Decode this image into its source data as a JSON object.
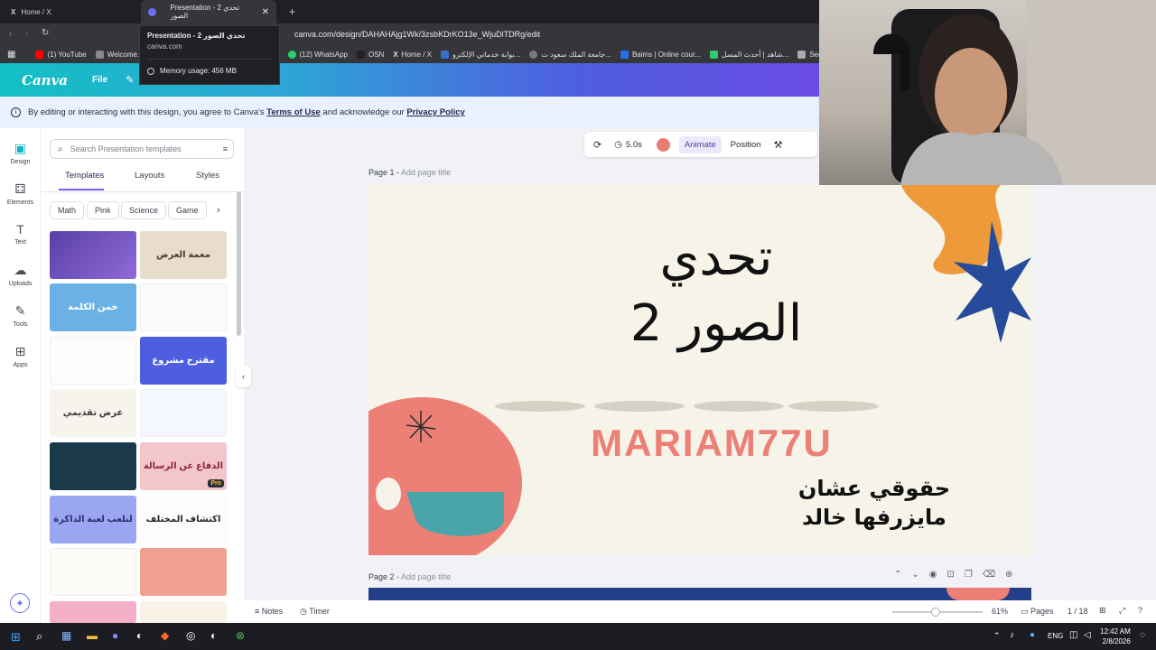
{
  "browser": {
    "tabs": [
      {
        "label": "Home / X",
        "active": false
      },
      {
        "label": "Presentation - 2 تحدي الصور",
        "active": true
      }
    ],
    "url": "canva.com/design/DAHAHAjg1Wk/3zsbKDrKO13e_WjuDlTDRg/edit",
    "tooltip": {
      "title": "Presentation - 2 تحدي الصور",
      "domain": "canva.com",
      "memory": "Memory usage: 456 MB"
    },
    "bookmarks": [
      {
        "label": "(1) YouTube",
        "color": "#ff0000"
      },
      {
        "label": "Welcome...",
        "color": "#888888"
      },
      {
        "label": "(12) WhatsApp",
        "color": "#25d366"
      },
      {
        "label": "OSN",
        "color": "#222222"
      },
      {
        "label": "Home / X",
        "color": "#000000"
      },
      {
        "label": "بوابة خدماتي الإلكترو...",
        "color": "#3b6ccb"
      },
      {
        "label": "جامعة الملك سعود ت...",
        "color": "#7a7a7a"
      },
      {
        "label": "Baims | Online cour...",
        "color": "#2a6ef0"
      },
      {
        "label": "شاهد | أحدث المسل...",
        "color": "#2ecc71"
      },
      {
        "label": "See",
        "color": "#aaaaaa"
      }
    ]
  },
  "canva": {
    "logo": "Canva",
    "menu_file": "File",
    "notice": {
      "prefix": "By editing or interacting with this design, you agree to Canva's",
      "terms": "Terms of Use",
      "middle": "and acknowledge our",
      "privacy": "Privacy Policy"
    },
    "nav": [
      {
        "label": "Design",
        "icon": "design-icon"
      },
      {
        "label": "Elements",
        "icon": "elements-icon"
      },
      {
        "label": "Text",
        "icon": "text-icon"
      },
      {
        "label": "Uploads",
        "icon": "uploads-icon"
      },
      {
        "label": "Tools",
        "icon": "tools-icon"
      },
      {
        "label": "Apps",
        "icon": "apps-icon"
      }
    ],
    "search_placeholder": "Search Presentation templates",
    "panel_tabs": [
      "Templates",
      "Layouts",
      "Styles"
    ],
    "chips": [
      "Math",
      "Pink",
      "Science",
      "Game"
    ],
    "thumbs": [
      "",
      "معمة العرض",
      "خمن الكلمة",
      "",
      "",
      "مقترح مشروع",
      "عرض تقديمي",
      "",
      "",
      "الدفاع عن الرسالة",
      "لنلعب لعبة الذاكرة",
      "اكتشاف المختلف",
      "",
      "",
      "",
      ""
    ],
    "pro_badge": "Pro",
    "toolbar": {
      "duration": "5.0s",
      "animate": "Animate",
      "position": "Position",
      "color": "#e87d74"
    },
    "page1_label": "Page 1 -",
    "page2_label": "Page 2 -",
    "add_title": "Add page title",
    "slide": {
      "title_line1": "تحدي",
      "title_line2": "الصور 2",
      "name": "MARIAM77U",
      "credit_line1": "حقوقي عشان",
      "credit_line2": "مايزرفها خالد"
    },
    "bottom": {
      "notes": "Notes",
      "timer": "Timer",
      "zoom": "61%",
      "pages_label": "Pages",
      "page_count": "1 / 18"
    }
  },
  "taskbar": {
    "lang": "ENG",
    "time": "12:42 AM",
    "date": "2/8/2026"
  }
}
